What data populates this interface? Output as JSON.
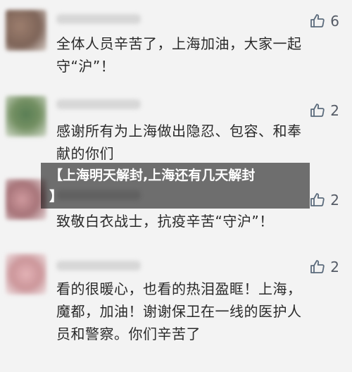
{
  "comments": [
    {
      "text": "全体人员辛苦了，上海加油，大家一起\n守“沪”！",
      "likes": "6",
      "avatar_color": "#7a5a46"
    },
    {
      "text": "感谢所有为上海做出隐忍、包容、和奉\n献的你们",
      "likes": "2",
      "avatar_color": "#3f6a39"
    },
    {
      "text": "致敬白衣战士，抗疫辛苦“守沪”！",
      "likes": "2",
      "avatar_color": "#b8737b"
    },
    {
      "text": "看的很暖心，也看的热泪盈眶！上海，\n魔都，加油！谢谢保卫在一线的医护人\n员和警察。你们辛苦了",
      "likes": "2",
      "avatar_color": "#d49a9e"
    }
  ],
  "overlay": {
    "title": "【上海明天解封,上海还有几天解封\n】"
  },
  "icons": {
    "like": "thumbs-up-outline-icon"
  }
}
